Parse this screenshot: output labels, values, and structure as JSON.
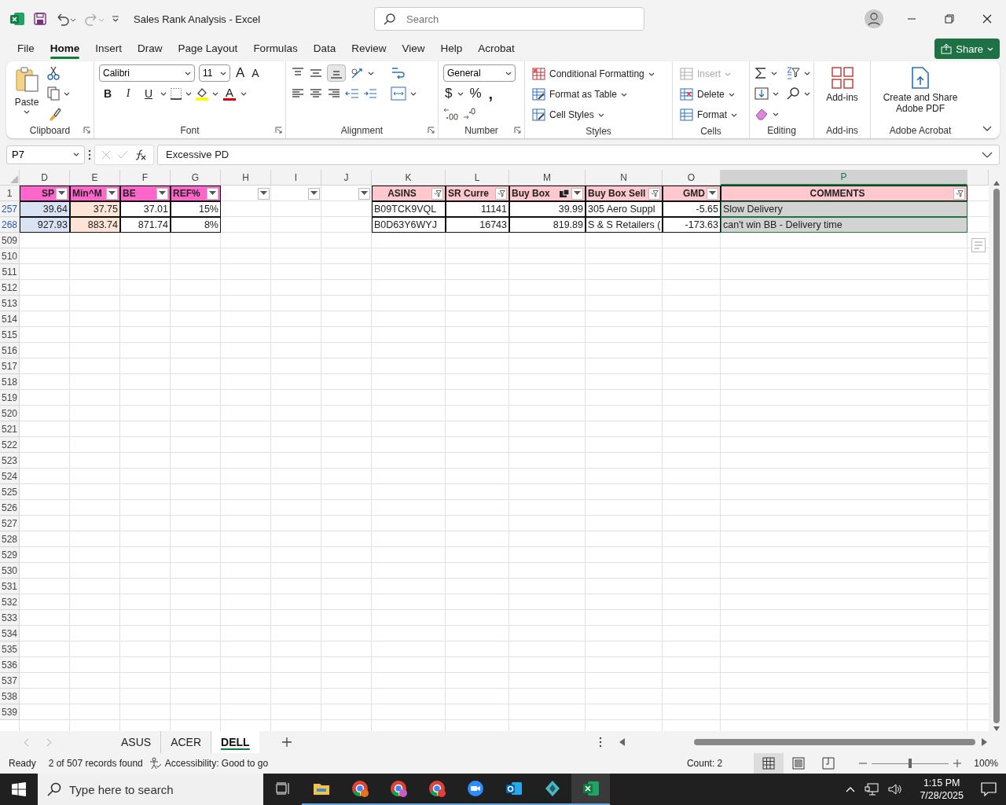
{
  "window": {
    "title": "Sales Rank Analysis  -  Excel",
    "search_placeholder": "Search"
  },
  "menu_tabs": [
    {
      "label": "File",
      "selected": false
    },
    {
      "label": "Home",
      "selected": true
    },
    {
      "label": "Insert",
      "selected": false
    },
    {
      "label": "Draw",
      "selected": false
    },
    {
      "label": "Page Layout",
      "selected": false
    },
    {
      "label": "Formulas",
      "selected": false
    },
    {
      "label": "Data",
      "selected": false
    },
    {
      "label": "Review",
      "selected": false
    },
    {
      "label": "View",
      "selected": false
    },
    {
      "label": "Help",
      "selected": false
    },
    {
      "label": "Acrobat",
      "selected": false
    }
  ],
  "share_button": "Share",
  "ribbon": [
    {
      "kind": "clipboard",
      "label": "Clipboard",
      "launcher": true,
      "paste": "Paste"
    },
    {
      "kind": "font",
      "label": "Font",
      "launcher": true,
      "font_name": "Calibri",
      "font_size": "11",
      "grow": "A",
      "shrink": "A",
      "styles": [
        "B",
        "I",
        "U"
      ],
      "font_color": "A"
    },
    {
      "kind": "alignment",
      "label": "Alignment",
      "launcher": true
    },
    {
      "kind": "number",
      "label": "Number",
      "launcher": true,
      "format": "General",
      "symbols": [
        "$",
        "%",
        ","
      ]
    },
    {
      "kind": "styles",
      "label": "Styles",
      "commands": [
        "Conditional Formatting",
        "Format as Table",
        "Cell Styles"
      ]
    },
    {
      "kind": "cells",
      "label": "Cells",
      "commands": [
        {
          "label": "Insert",
          "disabled": true
        },
        {
          "label": "Delete",
          "disabled": false
        },
        {
          "label": "Format",
          "disabled": false
        }
      ]
    },
    {
      "kind": "editing",
      "label": "Editing"
    },
    {
      "kind": "addins",
      "label": "Add-ins",
      "button": "Add-ins"
    },
    {
      "kind": "acrobat",
      "label": "Adobe Acrobat",
      "button": "Create and Share Adobe PDF"
    }
  ],
  "formula_bar": {
    "name_box": "P7",
    "formula": "Excessive PD"
  },
  "sheet": {
    "columns": [
      {
        "letter": "D",
        "selected": false,
        "numeric": true,
        "data_cells": {
          "color": "#dae3f3"
        },
        "header": {
          "title": "SP",
          "color": "#ff66cc",
          "kind": "right",
          "filtered": false
        }
      },
      {
        "letter": "E",
        "selected": false,
        "numeric": true,
        "data_cells": {
          "color": "#fce4d6"
        },
        "header": {
          "title": "Min^M",
          "color": "#ff66cc",
          "kind": "left",
          "filtered": false
        }
      },
      {
        "letter": "F",
        "selected": false,
        "numeric": true,
        "header": {
          "title": "BE",
          "color": "#ff66cc",
          "kind": "left",
          "filtered": false
        }
      },
      {
        "letter": "G",
        "selected": false,
        "numeric": true,
        "header": {
          "title": "REF%",
          "color": "#ff66cc",
          "kind": "left",
          "filtered": false
        }
      },
      {
        "letter": "H",
        "selected": false,
        "header": {
          "filtered": false
        }
      },
      {
        "letter": "I",
        "selected": false,
        "header": {
          "filtered": false
        }
      },
      {
        "letter": "J",
        "selected": false,
        "header": {
          "filtered": false
        }
      },
      {
        "letter": "K",
        "selected": false,
        "numeric": false,
        "header": {
          "title": "ASINS",
          "color": "#ffc7ce",
          "kind": "center",
          "filtered": true
        }
      },
      {
        "letter": "L",
        "selected": false,
        "numeric": true,
        "header": {
          "title": "SR Curre",
          "color": "#ffc7ce",
          "kind": "left",
          "filtered": true
        }
      },
      {
        "letter": "M",
        "selected": false,
        "numeric": true,
        "header": {
          "title": "Buy Box",
          "color": "#ffc7ce",
          "kind": "left",
          "filtered": false,
          "marker": true
        }
      },
      {
        "letter": "N",
        "selected": false,
        "numeric": false,
        "header": {
          "title": "Buy Box Sell",
          "color": "#ffc7ce",
          "kind": "left",
          "filtered": true
        }
      },
      {
        "letter": "O",
        "selected": false,
        "numeric": true,
        "header": {
          "title": "GMD",
          "color": "#ffc7ce",
          "kind": "right",
          "filtered": false
        }
      },
      {
        "letter": "P",
        "selected": true,
        "numeric": false,
        "header": {
          "title": "COMMENTS",
          "color": "#ffc7ce",
          "kind": "center",
          "filtered": true
        }
      }
    ],
    "header_row": "1",
    "rows": [
      {
        "number": "257",
        "filtered": true,
        "cells": {
          "D": "39.64",
          "E": "37.75",
          "F": "37.01",
          "G": "15%",
          "K": "B09TCK9VQL",
          "L": "11141",
          "M": "39.99",
          "N": "305 Aero Suppl",
          "O": "-5.65",
          "P": "Slow Delivery"
        }
      },
      {
        "number": "268",
        "filtered": true,
        "cells": {
          "D": "927.93",
          "E": "883.74",
          "F": "871.74",
          "G": "8%",
          "K": "B0D63Y6WYJ",
          "L": "16743",
          "M": "819.89",
          "N": "S & S Retailers (",
          "O": "-173.63",
          "P": "can't win BB - Delivery time"
        }
      }
    ],
    "empty_rows": [
      "509",
      "510",
      "511",
      "512",
      "513",
      "514",
      "515",
      "516",
      "517",
      "518",
      "519",
      "520",
      "521",
      "522",
      "523",
      "524",
      "525",
      "526",
      "527",
      "528",
      "529",
      "530",
      "531",
      "532",
      "533",
      "534",
      "535",
      "536",
      "537",
      "538",
      "539"
    ]
  },
  "sheet_tabs": [
    {
      "label": "ASUS",
      "selected": false
    },
    {
      "label": "ACER",
      "selected": false
    },
    {
      "label": "DELL",
      "selected": true
    }
  ],
  "status_bar": {
    "mode": "Ready",
    "records": "2 of 507 records found",
    "accessibility": "Accessibility: Good to go",
    "count": "Count: 2",
    "views": [
      {
        "kind": "normal",
        "selected": true
      },
      {
        "kind": "page_layout",
        "selected": false
      },
      {
        "kind": "page_break",
        "selected": false
      }
    ],
    "zoom": {
      "level": 0.5,
      "label": "100%"
    }
  },
  "taskbar": {
    "search_placeholder": "Type here to search",
    "apps": [
      {
        "kind": "folder",
        "selected": false
      },
      {
        "kind": "chrome",
        "selected": false,
        "color": "#e8711c"
      },
      {
        "kind": "chrome",
        "selected": false,
        "color": "#c55ec5"
      },
      {
        "kind": "chrome",
        "selected": false,
        "color": "#e04040"
      },
      {
        "kind": "zoom",
        "selected": false
      },
      {
        "kind": "outlook",
        "selected": false
      },
      {
        "kind": "diamond",
        "selected": false
      },
      {
        "kind": "excel",
        "selected": true
      }
    ],
    "time": "1:15 PM",
    "date": "7/28/2025"
  }
}
